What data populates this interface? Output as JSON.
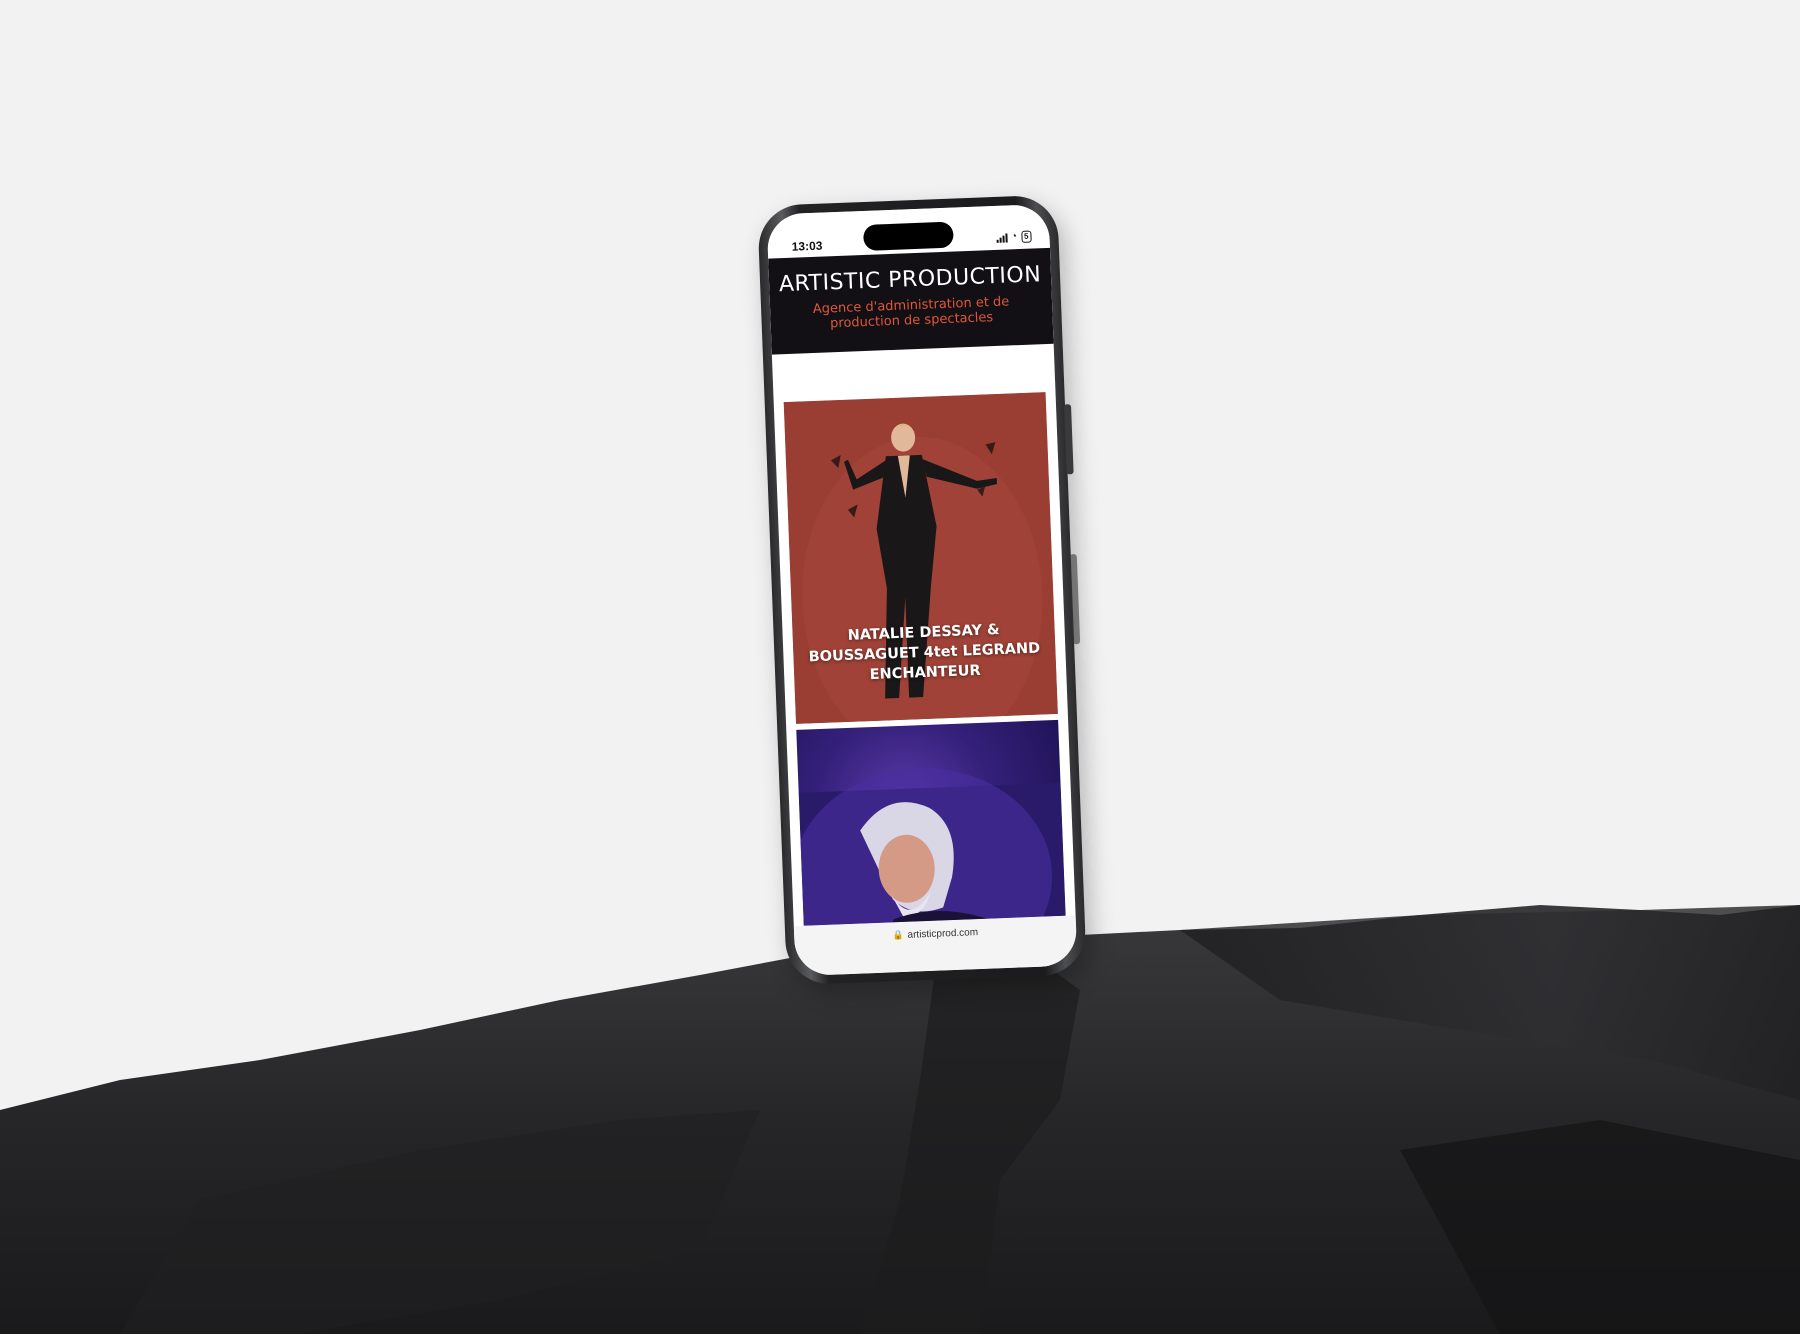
{
  "status": {
    "time": "13:03",
    "battery": "5"
  },
  "site": {
    "title": "ARTISTIC PRODUCTION",
    "subtitle": "Agence d'administration et de production de spectacles"
  },
  "cards": [
    {
      "title": "NATALIE DESSAY & BOUSSAGUET 4tet LEGRAND ENCHANTEUR"
    },
    {
      "title": ""
    }
  ],
  "browser": {
    "url": "artisticprod.com"
  },
  "colors": {
    "background": "#f2f2f2",
    "header_bg": "#121015",
    "accent": "#e0563b",
    "card1_bg": "#9a3e34",
    "card2_bg": "#34207a",
    "rock": "#2b2b2d"
  },
  "icons": [
    "signal-icon",
    "wifi-icon",
    "battery-icon",
    "lock-icon"
  ]
}
